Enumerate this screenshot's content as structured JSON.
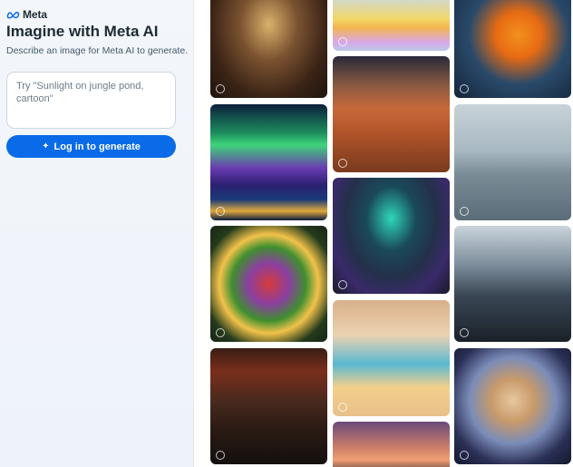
{
  "brand": {
    "name": "Meta",
    "logo_icon": "meta-infinity-icon"
  },
  "header": {
    "title": "Imagine with Meta AI",
    "subtitle": "Describe an image for Meta AI to generate."
  },
  "prompt": {
    "placeholder": "Try \"Sunlight on jungle pond, cartoon\"",
    "value": ""
  },
  "generate_button": {
    "label": "Log in to generate",
    "icon": "sparkle-icon"
  },
  "colors": {
    "accent": "#0a6be8",
    "text": "#1c2b33",
    "muted": "#465a69"
  },
  "gallery": {
    "images": [
      {
        "subject": "library"
      },
      {
        "subject": "rubber ducks"
      },
      {
        "subject": "butterfly"
      },
      {
        "subject": "aurora"
      },
      {
        "subject": "race car on mars"
      },
      {
        "subject": "dog in water"
      },
      {
        "subject": "fruit platter"
      },
      {
        "subject": "astronauts"
      },
      {
        "subject": "city"
      },
      {
        "subject": "lantern street"
      },
      {
        "subject": "bird character"
      },
      {
        "subject": "cat astronaut"
      },
      {
        "subject": "castle"
      }
    ]
  }
}
